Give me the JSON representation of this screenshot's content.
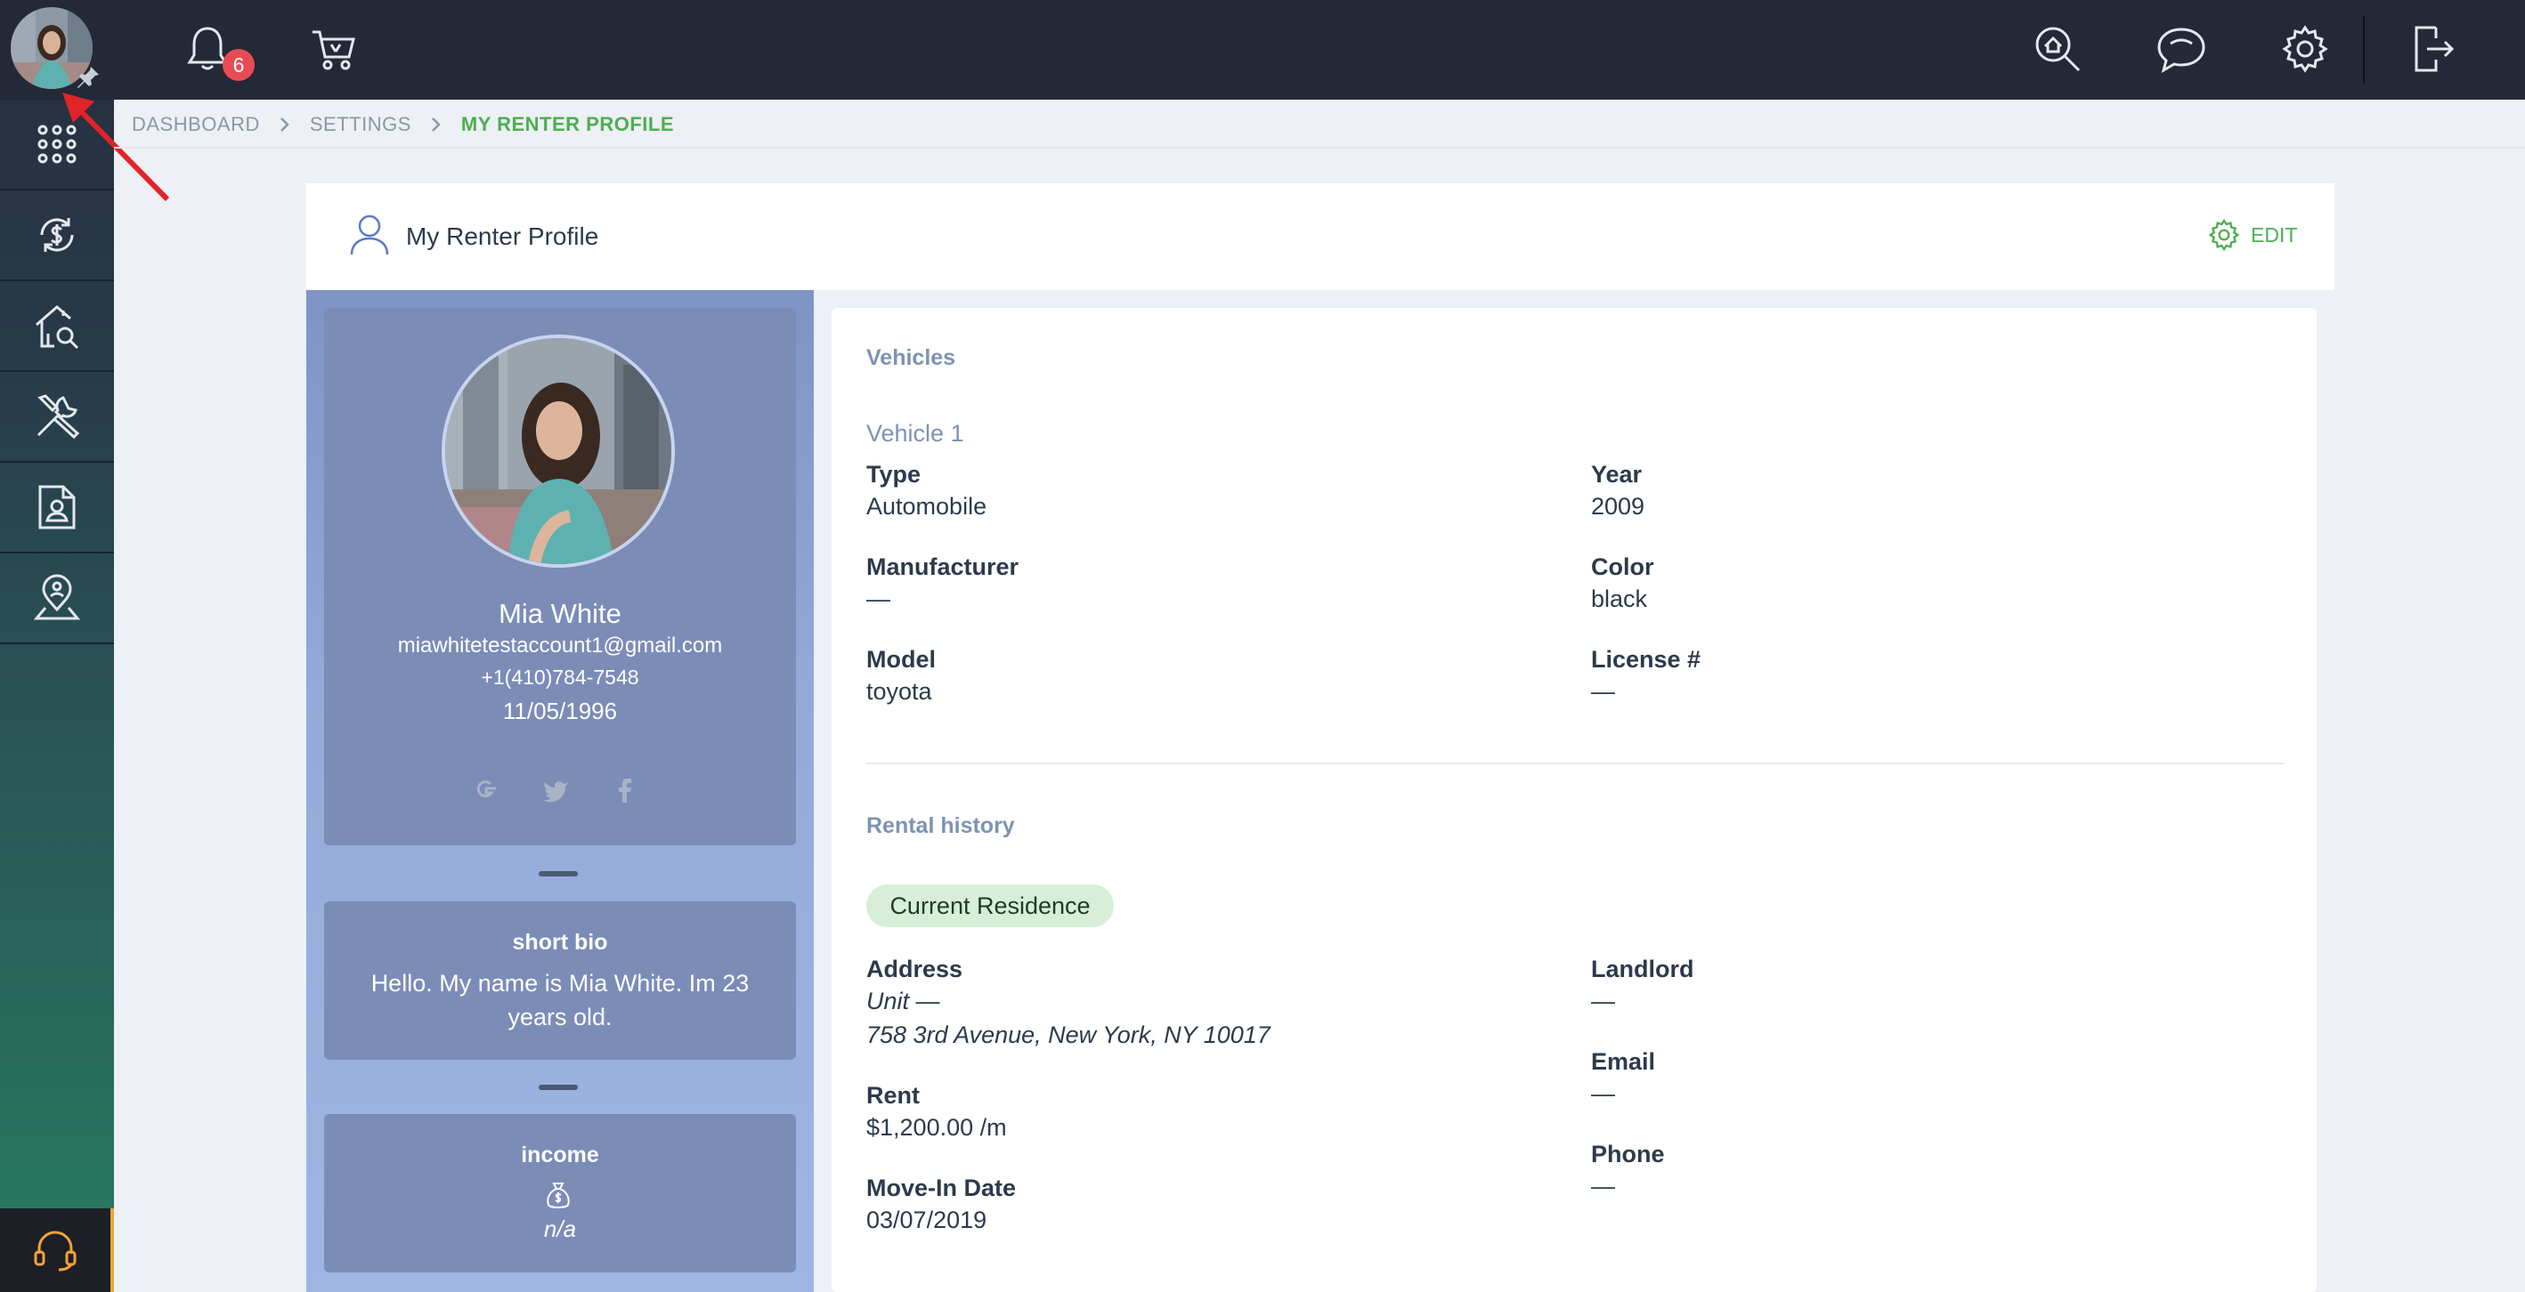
{
  "topbar": {
    "notification_count": "6"
  },
  "breadcrumb": [
    {
      "label": "DASHBOARD"
    },
    {
      "label": "SETTINGS"
    },
    {
      "label": "MY RENTER PROFILE"
    }
  ],
  "card": {
    "title": "My Renter Profile",
    "edit_label": "EDIT"
  },
  "profile": {
    "name": "Mia White",
    "email": "miawhitetestaccount1@gmail.com",
    "phone": "+1(410)784-7548",
    "dob": "11/05/1996"
  },
  "bio": {
    "title": "short bio",
    "text": "Hello. My name is Mia White. Im 23 years old."
  },
  "income": {
    "title": "income",
    "value": "n/a"
  },
  "vehicles": {
    "section_title": "Vehicles",
    "vehicle_title": "Vehicle 1",
    "type_label": "Type",
    "type_value": "Automobile",
    "year_label": "Year",
    "year_value": "2009",
    "manufacturer_label": "Manufacturer",
    "manufacturer_value": "—",
    "color_label": "Color",
    "color_value": "black",
    "model_label": "Model",
    "model_value": "toyota",
    "license_label": "License #",
    "license_value": "—"
  },
  "rental_history": {
    "section_title": "Rental history",
    "badge": "Current Residence",
    "address_label": "Address",
    "unit_value": "Unit —",
    "address_value": "758 3rd Avenue, New York, NY 10017",
    "rent_label": "Rent",
    "rent_value": "$1,200.00 /m",
    "movein_label": "Move-In Date",
    "movein_value": "03/07/2019",
    "landlord_label": "Landlord",
    "landlord_value": "—",
    "email_label": "Email",
    "email_value": "—",
    "phone_label": "Phone",
    "phone_value": "—"
  },
  "colors": {
    "accent_green": "#4caf50",
    "topbar": "#232937",
    "badge_red": "#e94b55"
  }
}
